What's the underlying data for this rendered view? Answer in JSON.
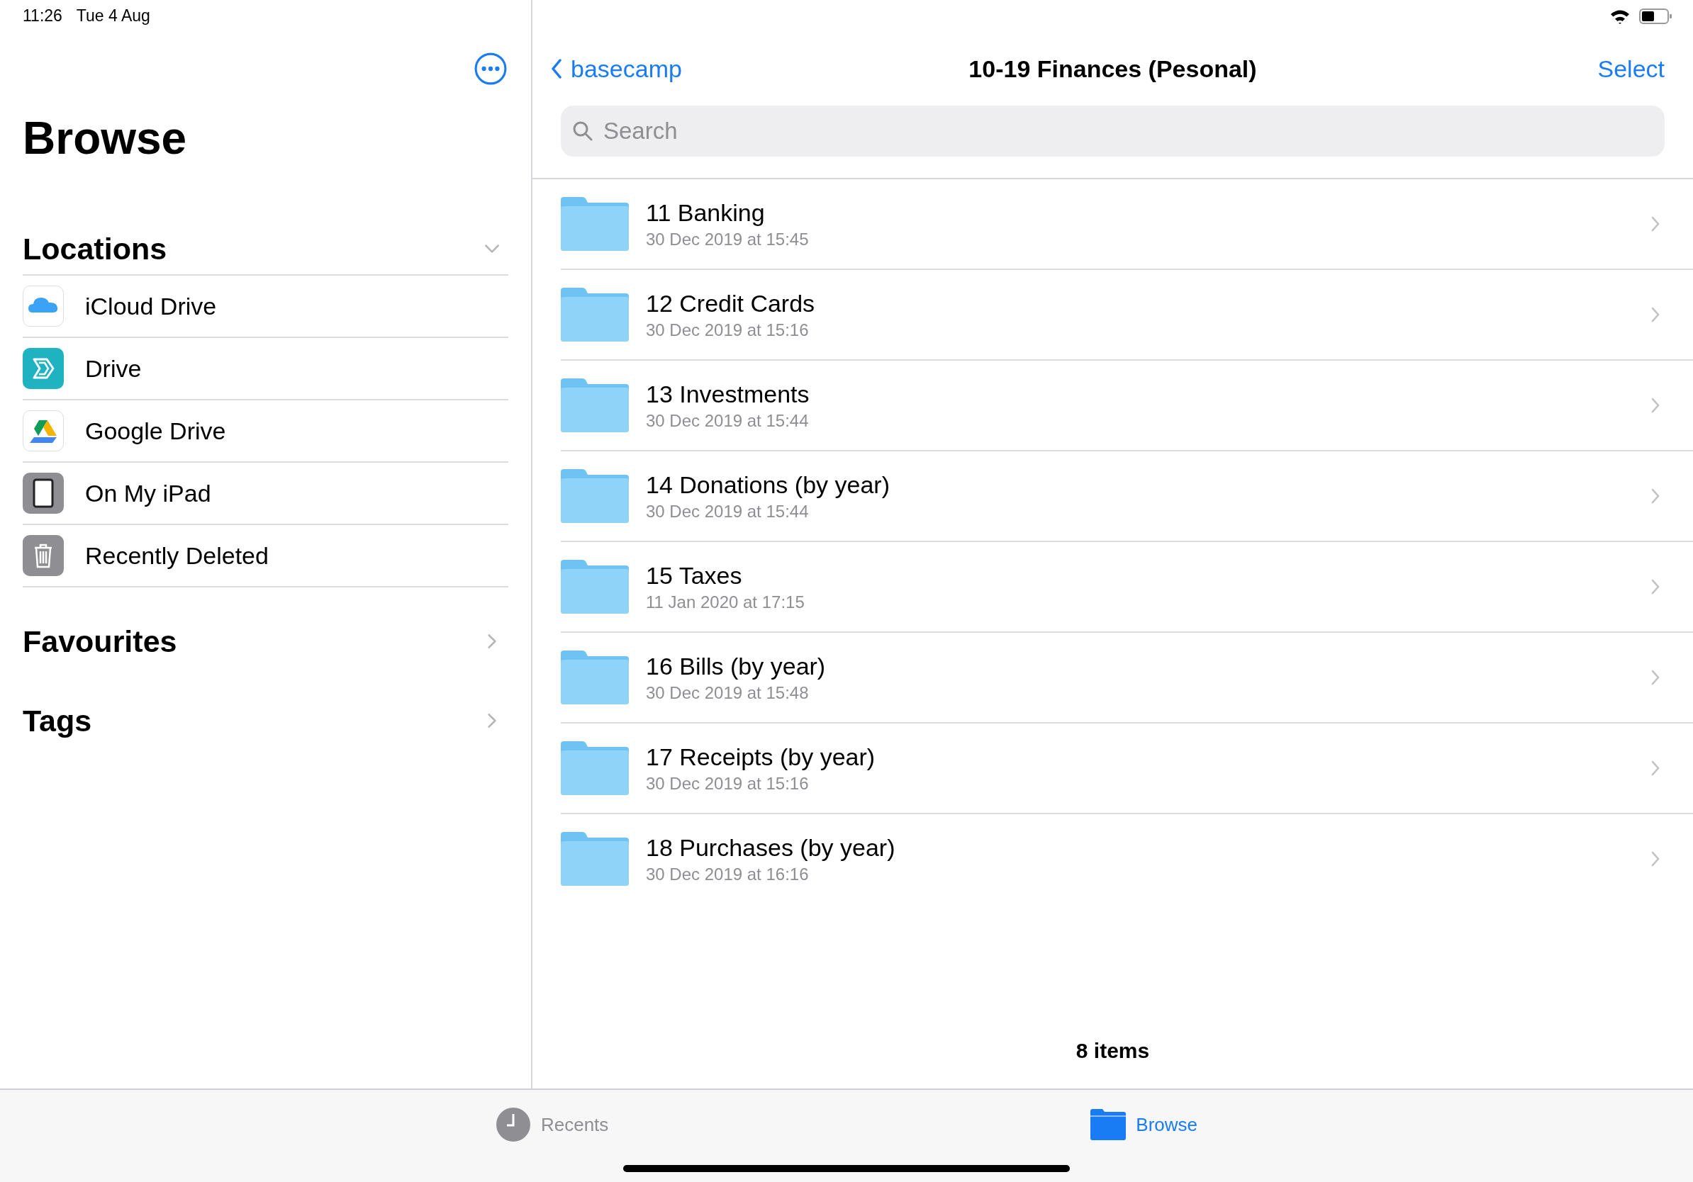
{
  "status_bar": {
    "time": "11:26",
    "date": "Tue 4 Aug"
  },
  "sidebar": {
    "title": "Browse",
    "sections": [
      {
        "title": "Locations",
        "expanded": true,
        "items": [
          {
            "label": "iCloud Drive",
            "kind": "icloud"
          },
          {
            "label": "Drive",
            "kind": "drive"
          },
          {
            "label": "Google Drive",
            "kind": "gdrive"
          },
          {
            "label": "On My iPad",
            "kind": "ipad"
          },
          {
            "label": "Recently Deleted",
            "kind": "trash"
          }
        ]
      },
      {
        "title": "Favourites",
        "expanded": false
      },
      {
        "title": "Tags",
        "expanded": false
      }
    ]
  },
  "main": {
    "back": "basecamp",
    "title": "10-19 Finances (Pesonal)",
    "select": "Select",
    "search": {
      "placeholder": "Search"
    },
    "folders": [
      {
        "name": "11 Banking",
        "date": "30 Dec 2019 at 15:45"
      },
      {
        "name": "12 Credit Cards",
        "date": "30 Dec 2019 at 15:16"
      },
      {
        "name": "13 Investments",
        "date": "30 Dec 2019 at 15:44"
      },
      {
        "name": "14 Donations (by year)",
        "date": "30 Dec 2019 at 15:44"
      },
      {
        "name": "15 Taxes",
        "date": "11 Jan 2020 at 17:15"
      },
      {
        "name": "16 Bills (by year)",
        "date": "30 Dec 2019 at 15:48"
      },
      {
        "name": "17 Receipts (by year)",
        "date": "30 Dec 2019 at 15:16"
      },
      {
        "name": "18 Purchases (by year)",
        "date": "30 Dec 2019 at 16:16"
      }
    ],
    "footer": "8 items"
  },
  "tab_bar": {
    "tabs": [
      {
        "label": "Recents",
        "kind": "clock",
        "selected": false
      },
      {
        "label": "Browse",
        "kind": "folder",
        "selected": true
      }
    ]
  }
}
